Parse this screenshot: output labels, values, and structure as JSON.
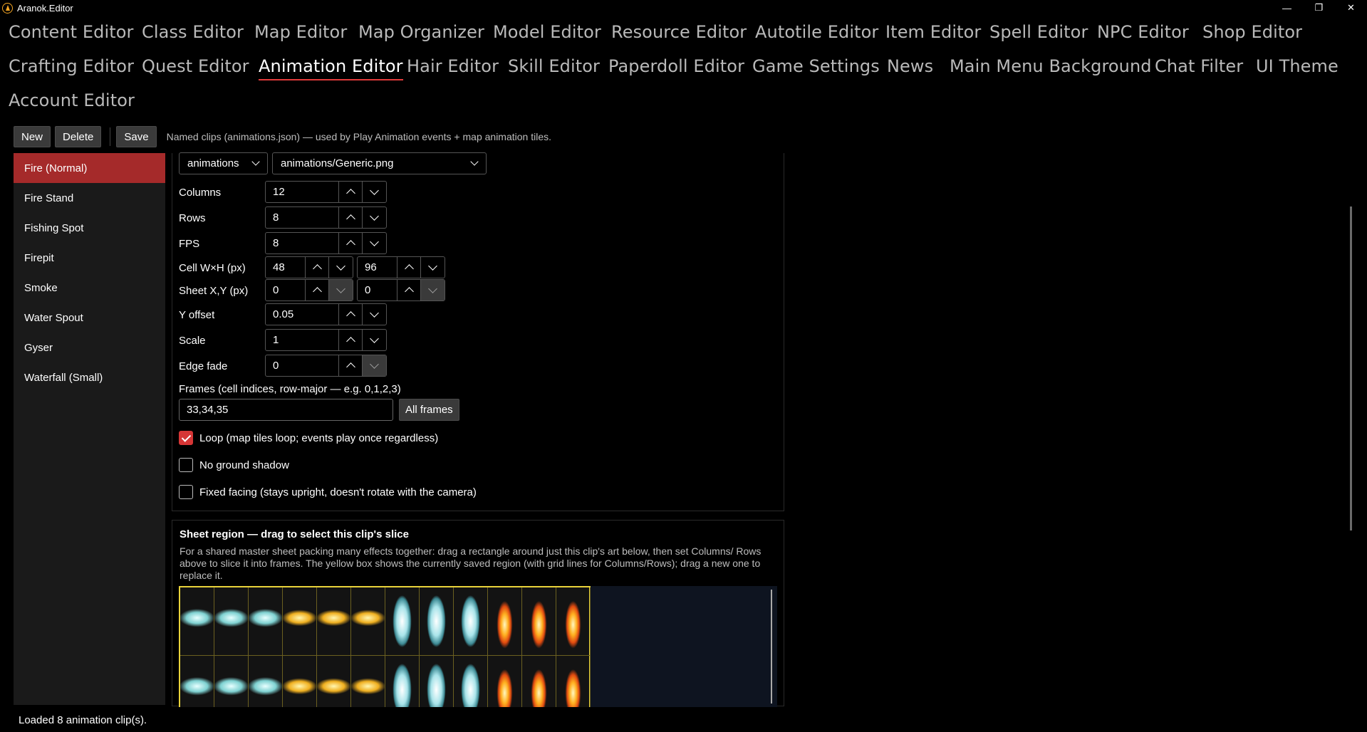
{
  "window": {
    "title": "Aranok.Editor",
    "minimize_icon": "—",
    "restore_icon": "❐",
    "close_icon": "✕"
  },
  "tabs": [
    {
      "label": "Content Editor"
    },
    {
      "label": "Class Editor"
    },
    {
      "label": "Map Editor"
    },
    {
      "label": "Map Organizer"
    },
    {
      "label": "Model Editor"
    },
    {
      "label": "Resource Editor"
    },
    {
      "label": "Autotile Editor"
    },
    {
      "label": "Item Editor"
    },
    {
      "label": "Spell Editor"
    },
    {
      "label": "NPC Editor"
    },
    {
      "label": "Shop Editor"
    },
    {
      "label": "Crafting Editor"
    },
    {
      "label": "Quest Editor"
    },
    {
      "label": "Animation Editor"
    },
    {
      "label": "Hair Editor"
    },
    {
      "label": "Skill Editor"
    },
    {
      "label": "Paperdoll Editor"
    },
    {
      "label": "Game Settings"
    },
    {
      "label": "News"
    },
    {
      "label": "Main Menu Background"
    },
    {
      "label": "Chat Filter"
    },
    {
      "label": "UI Theme"
    },
    {
      "label": "Account Editor"
    }
  ],
  "active_tab": "Animation Editor",
  "toolbar": {
    "new_label": "New",
    "delete_label": "Delete",
    "save_label": "Save",
    "description": "Named clips (animations.json) — used by Play Animation events + map animation tiles."
  },
  "clips": [
    {
      "label": "Fire (Normal)",
      "selected": true
    },
    {
      "label": "Fire Stand"
    },
    {
      "label": "Fishing Spot"
    },
    {
      "label": "Firepit"
    },
    {
      "label": "Smoke"
    },
    {
      "label": "Water Spout"
    },
    {
      "label": "Gyser"
    },
    {
      "label": "Waterfall (Small)"
    }
  ],
  "form": {
    "folder": "animations",
    "sheet": "animations/Generic.png",
    "columns_label": "Columns",
    "columns": "12",
    "rows_label": "Rows",
    "rows": "8",
    "fps_label": "FPS",
    "fps": "8",
    "cell_label": "Cell W×H (px)",
    "cell_w": "48",
    "cell_h": "96",
    "sheet_xy_label": "Sheet X,Y (px)",
    "sheet_x": "0",
    "sheet_y": "0",
    "y_offset_label": "Y offset",
    "y_offset": "0.05",
    "scale_label": "Scale",
    "scale": "1",
    "edge_fade_label": "Edge fade",
    "edge_fade": "0",
    "frames_label": "Frames (cell indices, row-major — e.g. 0,1,2,3)",
    "frames": "33,34,35",
    "all_frames_label": "All frames",
    "loop_label": "Loop (map tiles loop; events play once regardless)",
    "loop_checked": true,
    "no_shadow_label": "No ground shadow",
    "no_shadow_checked": false,
    "fixed_facing_label": "Fixed facing (stays upright, doesn't rotate with the camera)",
    "fixed_facing_checked": false
  },
  "sheet_region": {
    "title": "Sheet region — drag to select this clip's slice",
    "description": "For a shared master sheet packing many effects together: drag a rectangle around just this clip's art below, then set Columns/ Rows above to slice it into frames. The yellow box shows the currently saved region (with grid lines for Columns/Rows); drag a new one to replace it.",
    "highlight_color": "#e8d23a",
    "sprite_kinds": [
      "water-stream",
      "water-stream",
      "water-stream",
      "fire-stream",
      "fire-stream",
      "fire-stream",
      "water-spout",
      "water-spout",
      "water-spout",
      "fire",
      "fire",
      "fire"
    ]
  },
  "status": {
    "text": "Loaded 8 animation clip(s)."
  },
  "colors": {
    "accent": "#e23b3b",
    "selected_item": "#a52a2a",
    "checkbox_checked": "#d63636"
  }
}
